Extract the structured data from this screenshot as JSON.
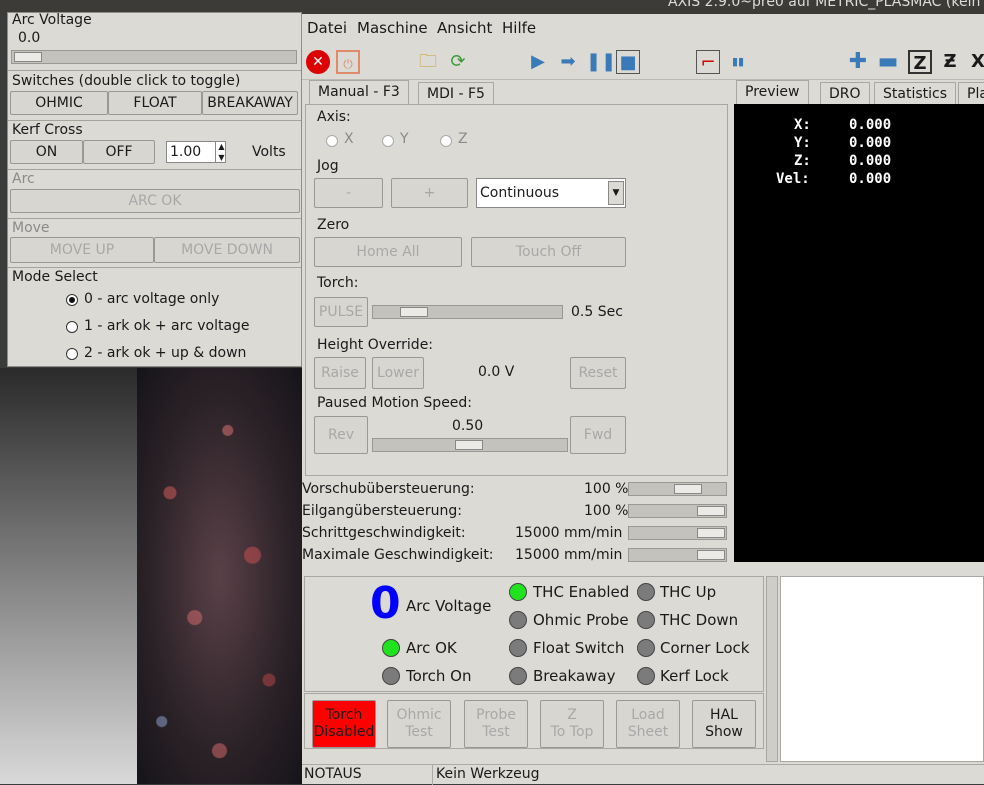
{
  "window": {
    "title": "AXIS 2.9.0~pre0 auf METRIC_PLASMAC (kein"
  },
  "left_panel": {
    "arc_voltage_label": "Arc Voltage",
    "arc_voltage_value": "0.0",
    "switches_label": "Switches (double click to toggle)",
    "switches": [
      "OHMIC",
      "FLOAT",
      "BREAKAWAY"
    ],
    "kerf_label": "Kerf Cross",
    "kerf_on": "ON",
    "kerf_off": "OFF",
    "kerf_value": "1.00",
    "kerf_unit": "Volts",
    "arc_label": "Arc",
    "arc_ok": "ARC OK",
    "move_label": "Move",
    "move_up": "MOVE UP",
    "move_down": "MOVE DOWN",
    "mode_label": "Mode Select",
    "modes": [
      "0 - arc voltage only",
      "1 - ark ok + arc voltage",
      "2 - ark ok + up & down"
    ],
    "selected_mode": 0
  },
  "menu": [
    "Datei",
    "Maschine",
    "Ansicht",
    "Hilfe"
  ],
  "tabs": {
    "manual": "Manual - F3",
    "mdi": "MDI - F5"
  },
  "manual": {
    "axis_label": "Axis:",
    "axes": [
      "X",
      "Y",
      "Z"
    ],
    "jog_label": "Jog",
    "jog_minus": "-",
    "jog_plus": "+",
    "jog_mode": "Continuous",
    "zero_label": "Zero",
    "home_all": "Home All",
    "touch_off": "Touch Off",
    "torch_label": "Torch:",
    "pulse": "PULSE",
    "pulse_value": "0.5 Sec",
    "height_label": "Height Override:",
    "raise": "Raise",
    "lower": "Lower",
    "height_value": "0.0 V",
    "reset": "Reset",
    "paused_label": "Paused Motion Speed:",
    "rev": "Rev",
    "paused_value": "0.50",
    "fwd": "Fwd"
  },
  "overrides": [
    {
      "label": "Vorschubübersteuerung:",
      "value": "100 %"
    },
    {
      "label": "Eilgangübersteuerung:",
      "value": "100 %"
    },
    {
      "label": "Schrittgeschwindigkeit:",
      "value": "15000 mm/min"
    },
    {
      "label": "Maximale Geschwindigkeit:",
      "value": "15000 mm/min"
    }
  ],
  "preview_tabs": [
    "Preview",
    "DRO",
    "Statistics",
    "Pla"
  ],
  "dro": [
    {
      "axis": "X:",
      "value": "0.000"
    },
    {
      "axis": "Y:",
      "value": "0.000"
    },
    {
      "axis": "Z:",
      "value": "0.000"
    },
    {
      "axis": "Vel:",
      "value": "0.000"
    }
  ],
  "plasma": {
    "arc_voltage_big": "0",
    "arc_voltage_label": "Arc Voltage",
    "arc_ok": "Arc OK",
    "torch_on": "Torch On",
    "thc_enabled": "THC Enabled",
    "ohmic_probe": "Ohmic Probe",
    "float_switch": "Float Switch",
    "breakaway": "Breakaway",
    "thc_up": "THC Up",
    "thc_down": "THC Down",
    "corner_lock": "Corner Lock",
    "kerf_lock": "Kerf Lock"
  },
  "buttons": {
    "torch": [
      "Torch",
      "Disabled"
    ],
    "ohmic": [
      "Ohmic",
      "Test"
    ],
    "probe": [
      "Probe",
      "Test"
    ],
    "ztop": [
      "Z",
      "To Top"
    ],
    "load": [
      "Load",
      "Sheet"
    ],
    "hal": [
      "HAL",
      "Show"
    ]
  },
  "status": {
    "estop": "NOTAUS",
    "tool": "Kein Werkzeug"
  },
  "colors": {
    "led_on": "#1ee31e",
    "led_off": "#7b7b7b",
    "torch_disabled": "#ff0000",
    "arc_big": "#0000ff"
  }
}
